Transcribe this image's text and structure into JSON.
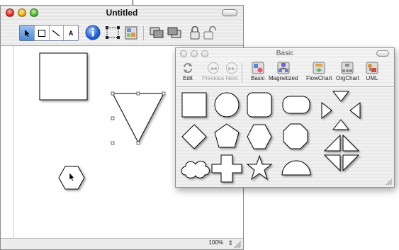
{
  "main_window": {
    "title": "Untitled",
    "tools": {
      "pointer": "pointer-tool",
      "rectangle": "rectangle-tool",
      "line": "line-tool",
      "text_label": "A"
    },
    "zoom": "100%"
  },
  "palette": {
    "title": "Basic",
    "toolbar": [
      {
        "label": "Edit",
        "enabled": true,
        "icon": "edit-icon"
      },
      {
        "label": "Previous",
        "enabled": false,
        "icon": "previous-icon"
      },
      {
        "label": "Next",
        "enabled": false,
        "icon": "next-icon"
      },
      {
        "label": "Basic",
        "enabled": true,
        "icon": "basic-icon"
      },
      {
        "label": "Magnetized",
        "enabled": true,
        "icon": "magnetized-icon"
      },
      {
        "label": "FlowChart",
        "enabled": true,
        "icon": "flowchart-icon"
      },
      {
        "label": "OrgChart",
        "enabled": true,
        "icon": "orgchart-icon"
      },
      {
        "label": "UML",
        "enabled": true,
        "icon": "uml-icon"
      }
    ],
    "shapes": [
      "square",
      "circle",
      "rounded-square",
      "rounded-rectangle",
      "arrows-cross",
      "diamond",
      "pentagon",
      "hexagon",
      "octagon",
      "right-triangles",
      "cloud",
      "cross",
      "star",
      "half-circle",
      "corner-triangles"
    ]
  }
}
